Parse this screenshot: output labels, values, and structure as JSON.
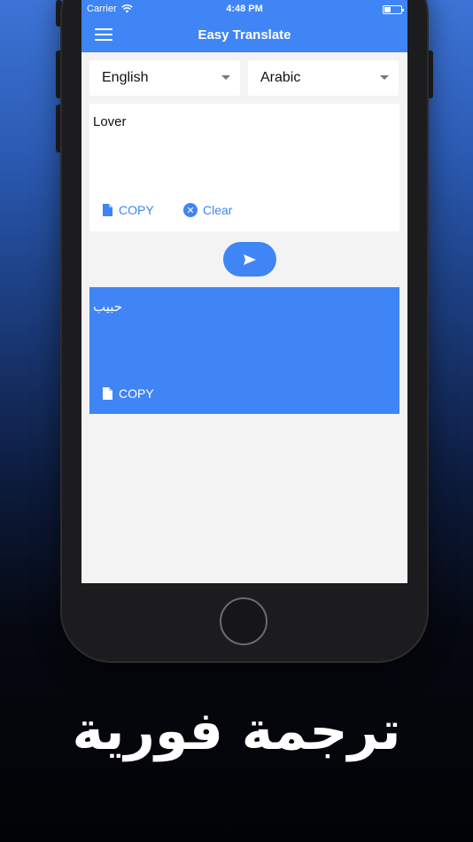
{
  "status_bar": {
    "carrier": "Carrier",
    "time": "4:48 PM"
  },
  "header": {
    "title": "Easy Translate",
    "menu_icon": "hamburger-menu-icon"
  },
  "languages": {
    "source": "English",
    "target": "Arabic"
  },
  "input": {
    "text": "Lover",
    "copy_label": "COPY",
    "clear_label": "Clear"
  },
  "output": {
    "text": "حبيب",
    "copy_label": "COPY"
  },
  "promo": {
    "text": "ترجمة فورية"
  },
  "colors": {
    "accent": "#3f85f5",
    "screen_bg": "#f3f3f3"
  }
}
